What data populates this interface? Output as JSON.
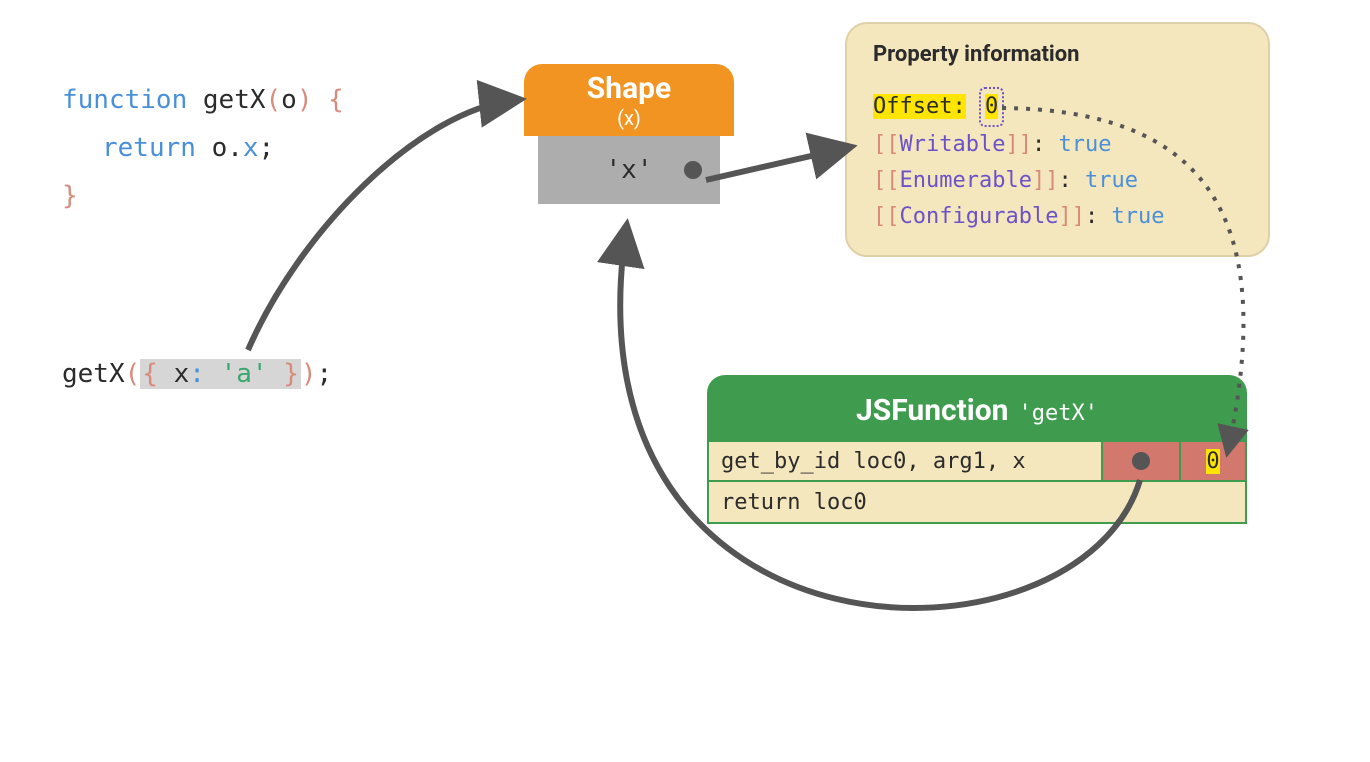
{
  "code": {
    "fn_kw": "function",
    "fn_name": "getX",
    "paren_open": "(",
    "param": "o",
    "paren_close": ")",
    "brace_open": "{",
    "return_kw": "return",
    "obj": "o",
    "dot": ".",
    "prop": "x",
    "semi": ";",
    "brace_close": "}",
    "call_name": "getX",
    "call_open": "(",
    "obj_open": "{",
    "key": "x",
    "colon": ":",
    "val": "'a'",
    "obj_close": "}",
    "call_close": ")",
    "call_semi": ";"
  },
  "shape": {
    "title": "Shape",
    "sub": "(x)",
    "cell": "'x'"
  },
  "propinfo": {
    "title": "Property information",
    "offset_label": "Offset:",
    "offset_value": "0",
    "writable_label": "Writable",
    "writable_value": "true",
    "enumerable_label": "Enumerable",
    "enumerable_value": "true",
    "configurable_label": "Configurable",
    "configurable_value": "true"
  },
  "jsfn": {
    "title": "JSFunction",
    "name": "'getX'",
    "row1_instr": "get_by_id loc0, arg1, x",
    "row1_cache_offset": "0",
    "row2_instr": "return loc0"
  }
}
